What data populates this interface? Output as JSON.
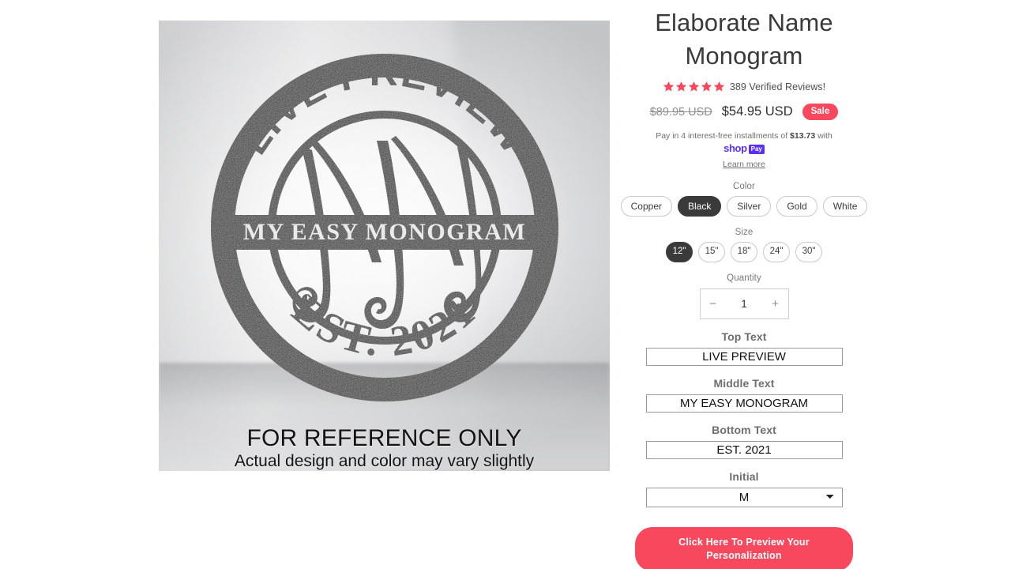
{
  "product": {
    "title": "Elaborate Name Monogram",
    "rating": {
      "stars": 5,
      "star_color": "#f8485e",
      "reviews_text": "389 Verified Reviews!"
    },
    "price": {
      "compare_at": "$89.95 USD",
      "current": "$54.95 USD",
      "badge": "Sale",
      "badge_color": "#f8485e"
    },
    "installments": {
      "prefix": "Pay in 4 interest-free installments of",
      "amount": "$13.73",
      "suffix": "with",
      "provider_word": "shop",
      "provider_tag": "Pay",
      "provider_color": "#5a31f4",
      "learn_more": "Learn more"
    }
  },
  "options": {
    "color": {
      "label": "Color",
      "selected": "Black",
      "values": [
        "Copper",
        "Black",
        "Silver",
        "Gold",
        "White"
      ]
    },
    "size": {
      "label": "Size",
      "selected": "12\"",
      "values": [
        "12\"",
        "15\"",
        "18\"",
        "24\"",
        "30\""
      ]
    },
    "quantity": {
      "label": "Quantity",
      "value": "1",
      "decrease_icon": "minus-icon",
      "increase_icon": "plus-icon",
      "decrease_glyph": "−",
      "increase_glyph": "+"
    }
  },
  "personalization": {
    "top_text": {
      "label": "Top Text",
      "value": "LIVE PREVIEW"
    },
    "middle_text": {
      "label": "Middle Text",
      "value": "MY EASY MONOGRAM"
    },
    "bottom_text": {
      "label": "Bottom Text",
      "value": "EST. 2021"
    },
    "initial": {
      "label": "Initial",
      "value": "M"
    },
    "cta": "Click Here To Preview Your Personalization"
  },
  "media": {
    "sign": {
      "top_arc_text": "LIVE PREVIEW",
      "banner_text": "MY EASY MONOGRAM",
      "bottom_arc_text": "EST. 2021",
      "monogram_letter": "M",
      "metal_color": "#2a2a2a"
    },
    "disclaimer_main": "FOR REFERENCE ONLY",
    "disclaimer_sub": "Actual design and color may vary slightly"
  }
}
